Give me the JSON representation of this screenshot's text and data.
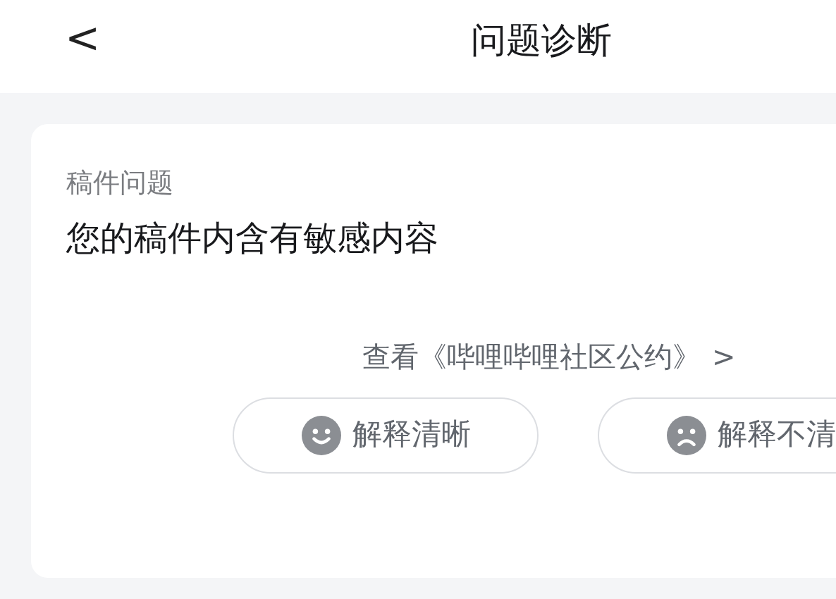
{
  "header": {
    "back": "<",
    "title": "问题诊断"
  },
  "card": {
    "label": "稿件问题",
    "message": "您的稿件内含有敏感内容",
    "link": "查看《哔哩哔哩社区公约》",
    "link_arrow": ">",
    "feedback": [
      {
        "kind": "smile",
        "label": "解释清晰"
      },
      {
        "kind": "frown",
        "label": "解释不清"
      }
    ]
  }
}
